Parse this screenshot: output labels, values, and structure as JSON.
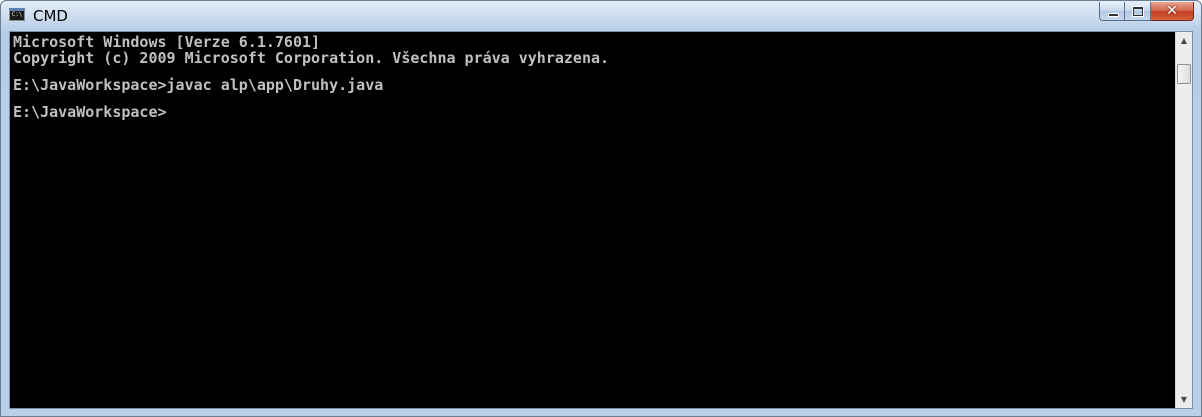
{
  "window": {
    "title": "CMD",
    "app_icon_glyph": "C:\\",
    "controls": {
      "minimize": "minimize-icon",
      "maximize": "maximize-icon",
      "close_glyph": "✕"
    }
  },
  "console": {
    "lines": [
      "Microsoft Windows [Verze 6.1.7601]",
      "Copyright (c) 2009 Microsoft Corporation. Všechna práva vyhrazena.",
      "",
      "E:\\JavaWorkspace>javac alp\\app\\Druhy.java",
      "",
      "E:\\JavaWorkspace>"
    ],
    "text_color": "#c0c0c0",
    "background_color": "#000000"
  },
  "scrollbar": {
    "up_arrow": "▲",
    "down_arrow": "▼"
  }
}
